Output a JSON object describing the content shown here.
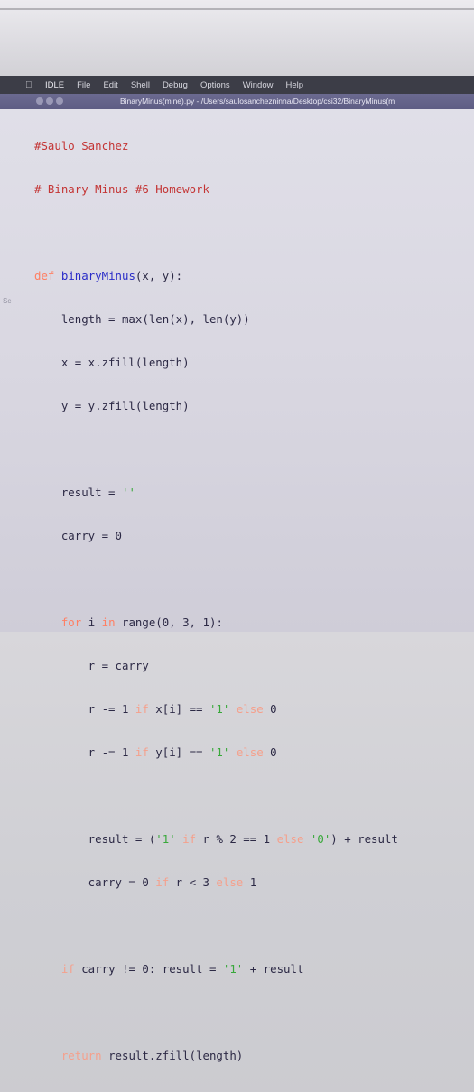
{
  "menubar": {
    "app": "IDLE",
    "items": [
      "File",
      "Edit",
      "Shell",
      "Debug",
      "Options",
      "Window",
      "Help"
    ]
  },
  "titlebar": {
    "title": "BinaryMinus(mine).py - /Users/saulosanchezninna/Desktop/csi32/BinaryMinus(m"
  },
  "sidebar": {
    "label": "Sc"
  },
  "code": {
    "c1": "#Saulo Sanchez",
    "c2": "# Binary Minus #6 Homework",
    "def_kw": "def",
    "fn_name": "binaryMinus",
    "def_rest": "(x, y):",
    "l_length": "    length = max(len(x), len(y))",
    "l_x": "    x = x.zfill(length)",
    "l_y": "    y = y.zfill(length)",
    "l_result_a": "    result = ",
    "l_result_str": "''",
    "l_carry": "    carry = 0",
    "for_indent": "    ",
    "for_kw": "for",
    "for_mid": " i ",
    "in_kw": "in",
    "for_rest": " range(0, 3, 1):",
    "r1": "        r = carry",
    "r2_a": "        r -= 1 ",
    "r2_if": "if",
    "r2_b": " x[i] == ",
    "r2_str": "'1'",
    "r2_sp": " ",
    "r2_else": "else",
    "r2_c": " 0",
    "r3_a": "        r -= 1 ",
    "r3_if": "if",
    "r3_b": " y[i] == ",
    "r3_str": "'1'",
    "r3_sp": " ",
    "r3_else": "else",
    "r3_c": " 0",
    "res_a": "        result = (",
    "res_s1": "'1'",
    "res_b": " ",
    "res_if": "if",
    "res_c": " r % 2 == 1 ",
    "res_else": "else",
    "res_d": " ",
    "res_s0": "'0'",
    "res_e": ") + result",
    "car_a": "        carry = 0 ",
    "car_if": "if",
    "car_b": " r < 3 ",
    "car_else": "else",
    "car_c": " 1",
    "ifc_indent": "    ",
    "ifc_kw": "if",
    "ifc_a": " carry != 0: result = ",
    "ifc_str": "'1'",
    "ifc_b": " + result",
    "ret_indent": "    ",
    "ret_kw": "return",
    "ret_rest": " result.zfill(length)"
  }
}
